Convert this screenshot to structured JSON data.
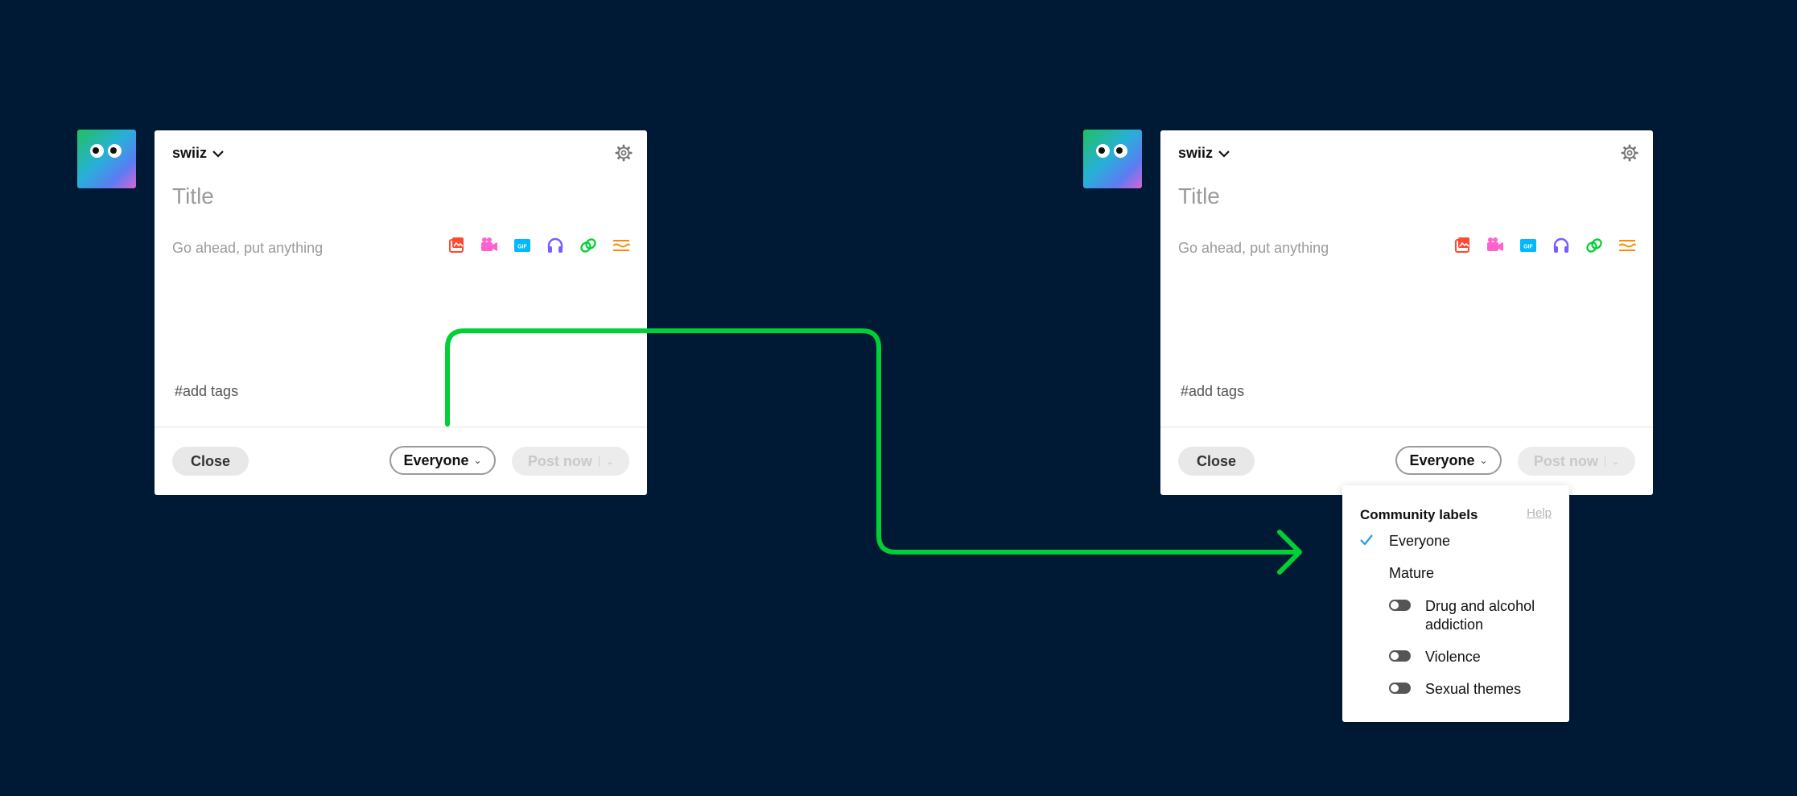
{
  "colors": {
    "background": "#001935",
    "arrow": "#00cf35",
    "check": "#1a9fe0"
  },
  "left": {
    "blog_name": "swiiz",
    "title_placeholder": "Title",
    "body_placeholder": "Go ahead, put anything",
    "tags_placeholder": "#add tags",
    "close_label": "Close",
    "audience_label": "Everyone",
    "post_label": "Post now"
  },
  "right": {
    "blog_name": "swiiz",
    "title_placeholder": "Title",
    "body_placeholder": "Go ahead, put anything",
    "tags_placeholder": "#add tags",
    "close_label": "Close",
    "audience_label": "Everyone",
    "post_label": "Post now"
  },
  "toolbar_icons": [
    "photo-icon",
    "video-icon",
    "gif-icon",
    "audio-icon",
    "link-icon",
    "text-block-icon"
  ],
  "dropdown": {
    "heading": "Community labels",
    "help": "Help",
    "options": [
      {
        "label": "Everyone",
        "selected": true
      },
      {
        "label": "Mature",
        "selected": false
      }
    ],
    "toggles": [
      {
        "label": "Drug and alcohol addiction",
        "on": false
      },
      {
        "label": "Violence",
        "on": false
      },
      {
        "label": "Sexual themes",
        "on": false
      }
    ]
  }
}
